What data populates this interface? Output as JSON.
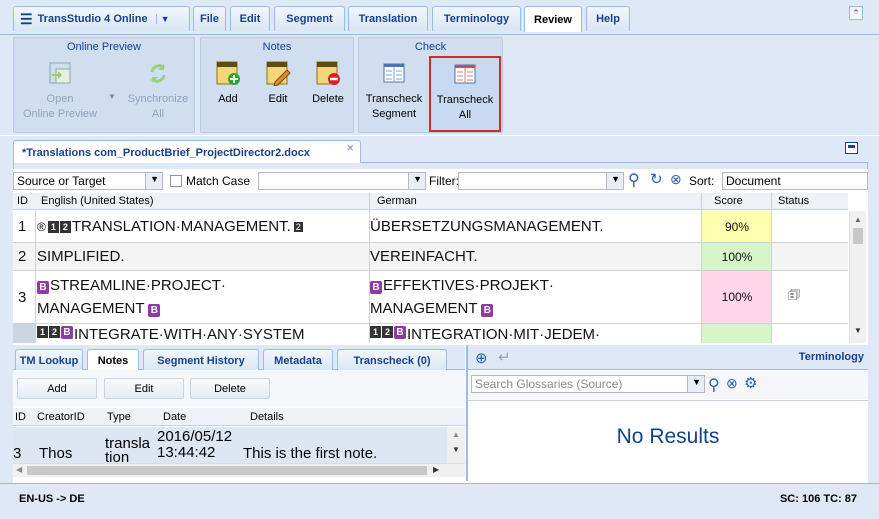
{
  "menu": {
    "app_title": "TransStudio 4 Online",
    "tabs": [
      "File",
      "Edit",
      "Segment",
      "Translation",
      "Terminology",
      "Review",
      "Help"
    ],
    "active_tab": "Review"
  },
  "ribbon": {
    "online_preview": {
      "title": "Online Preview",
      "open_line1": "Open",
      "open_line2": "Online Preview",
      "sync_line1": "Synchronize",
      "sync_line2": "All"
    },
    "notes": {
      "title": "Notes",
      "add": "Add",
      "edit": "Edit",
      "delete": "Delete"
    },
    "check": {
      "title": "Check",
      "seg_line1": "Transcheck",
      "seg_line2": "Segment",
      "all_line1": "Transcheck",
      "all_line2": "All"
    }
  },
  "document_tab": {
    "label": "*Translations com_ProductBrief_ProjectDirector2.docx"
  },
  "toolbar": {
    "search_scope": "Source or Target",
    "match_case": "Match Case",
    "search_value": "",
    "filter_label": "Filter:",
    "filter_value": "",
    "sort_label": "Sort:",
    "sort_value": "Document"
  },
  "grid": {
    "headers": {
      "id": "ID",
      "source": "English (United States)",
      "target": "German",
      "score": "Score",
      "status": "Status"
    },
    "rows": [
      {
        "id": "1",
        "source": "TRANSLATION·MANAGEMENT.",
        "target": "ÜBERSETZUNGSMANAGEMENT.",
        "score": "90%",
        "score_color": "#ffffb0"
      },
      {
        "id": "2",
        "source": "SIMPLIFIED.",
        "target": "VEREINFACHT.",
        "score": "100%",
        "score_color": "#d6f5c8"
      },
      {
        "id": "3",
        "source_line1": "STREAMLINE·PROJECT·",
        "source_line2": "MANAGEMENT",
        "target_line1": "EFFEKTIVES·PROJEKT·",
        "target_line2": "MANAGEMENT",
        "score": "100%",
        "score_color": "#ffd6ea"
      },
      {
        "id": "",
        "source": "INTEGRATE·WITH·ANY·SYSTEM",
        "target": "INTEGRATION·MIT·JEDEM·",
        "score": "",
        "score_color": "#d6f5c8"
      }
    ]
  },
  "bottom_left": {
    "tabs": [
      "TM Lookup",
      "Notes",
      "Segment History",
      "Metadata",
      "Transcheck (0)"
    ],
    "active_tab": "Notes",
    "buttons": {
      "add": "Add",
      "edit": "Edit",
      "delete": "Delete"
    },
    "headers": {
      "id": "ID",
      "creator": "CreatorID",
      "type": "Type",
      "date": "Date",
      "details": "Details"
    },
    "note": {
      "id": "3",
      "creator": "Thos",
      "type_line1": "transla",
      "type_line2": "tion",
      "date_line1": "2016/05/12",
      "date_line2": "13:44:42",
      "details": "This is the first note."
    }
  },
  "bottom_right": {
    "title": "Terminology",
    "search_placeholder": "Search Glossaries (Source)",
    "empty_text": "No Results"
  },
  "statusbar": {
    "lang_pair": "EN-US -> DE",
    "counts": "SC: 106 TC: 87"
  }
}
